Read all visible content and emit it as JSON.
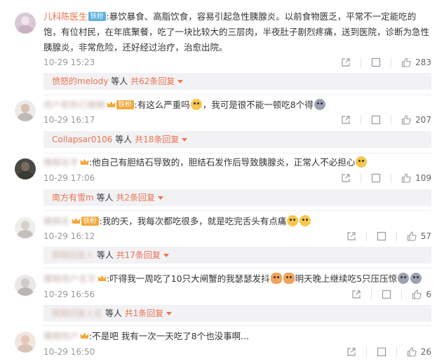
{
  "comments": [
    {
      "username": "儿科陈医生",
      "badge": "铁粉",
      "text": ":暴饮暴食、高脂饮食，容易引起急性胰腺炎。以前食物匮乏，平常不一定能吃的饱，有位村民，在年底聚餐，吃了一块比较大的三层肉，半夜肚子剧烈疼痛，送到医院，诊断为急性胰腺炎，非常危险，还好经过治疗，治愈出院。",
      "time": "10-29 15:23",
      "likes": "283",
      "reply_user": "愤怒的melody",
      "reply_mid": " 等人 ",
      "reply_count": "共62条回复"
    },
    {
      "username": "用户昵称已模糊",
      "badge": "铁粉",
      "text": ":有这么严重吗",
      "text2": "，我可是很不能一顿吃8个得",
      "time": "10-29 16:17",
      "likes": "207",
      "reply_user": "Collapsar0106",
      "reply_mid": " 等人 ",
      "reply_count": "共18条回复"
    },
    {
      "username": "模糊名字",
      "text": ":他自己有胆结石导致的，胆结石发作后导致胰腺炎，正常人不必担心",
      "time": "10-29 17:06",
      "likes": "109",
      "reply_user": "南方有雪m",
      "reply_mid": " 等人 ",
      "reply_count": "共2条回复"
    },
    {
      "username": "模糊名",
      "badge": "铁粉",
      "text": ":我的天，我每次都吃很多，就是吃完舌头有点痛",
      "time": "10-29 16:12",
      "likes": "57",
      "reply_user": "模糊回复人",
      "reply_mid": " 等人 ",
      "reply_count": "共17条回复"
    },
    {
      "username": "模糊用户名字",
      "text": ":吓得我一周吃了10只大闸蟹的我瑟瑟发抖",
      "text2": "明天晚上继续吃5只压压惊",
      "time": "10-29 16:56",
      "likes": "6",
      "reply_user": "模糊回复人名",
      "reply_mid": " 等人 ",
      "reply_count": "共1条回复"
    },
    {
      "username": "模糊用户",
      "text": ":不是吧 我有一次一天吃了8个也没事啊...",
      "time": "10-29 16:50",
      "likes": "26"
    }
  ],
  "icons": {
    "share": "share-icon",
    "comment": "comment-icon",
    "like": "thumbs-up-icon",
    "expand": "caret-down-icon"
  },
  "colors": {
    "username": "#eb7350",
    "time": "#999999",
    "reply_bg": "#f2f2f5",
    "badge_blue": "#5cb0e0",
    "badge_gold": "#f3a83b"
  }
}
